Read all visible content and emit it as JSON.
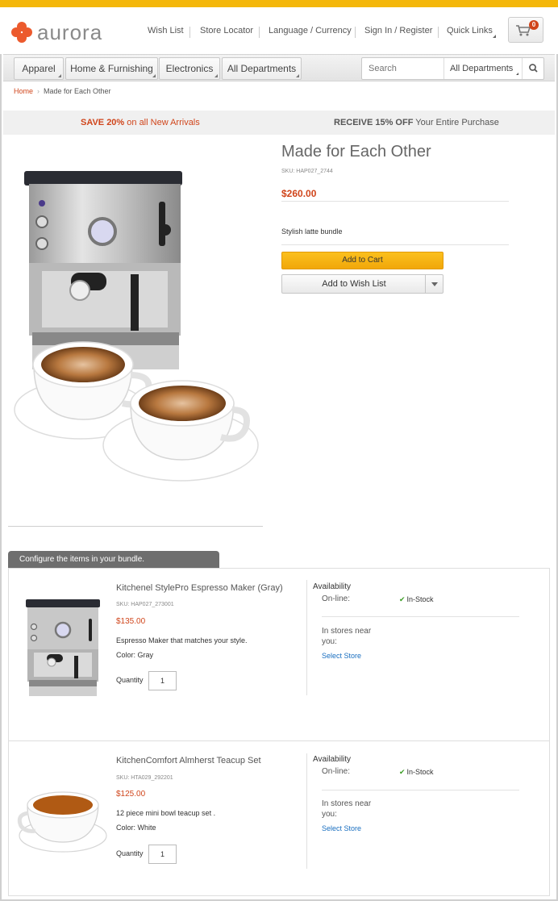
{
  "brand": {
    "name": "aurora"
  },
  "header": {
    "links": [
      "Wish List",
      "Store Locator",
      "Language / Currency",
      "Sign In / Register",
      "Quick Links"
    ],
    "cart_count": "0"
  },
  "nav": {
    "departments": [
      "Apparel",
      "Home & Furnishing",
      "Electronics",
      "All Departments"
    ],
    "search_placeholder": "Search",
    "search_department": "All Departments"
  },
  "breadcrumb": {
    "home": "Home",
    "current": "Made for Each Other"
  },
  "promo": {
    "left_bold": "SAVE 20%",
    "left_text": " on all New Arrivals",
    "right_bold": "RECEIVE 15% OFF",
    "right_text": " Your Entire Purchase"
  },
  "product": {
    "title": "Made for Each Other",
    "sku": "SKU: HAP027_2744",
    "price": "$260.00",
    "description": "Stylish latte bundle",
    "add_to_cart": "Add to Cart",
    "add_to_wishlist": "Add to Wish List"
  },
  "bundle": {
    "tab_label": "Configure the items in your bundle.",
    "items": [
      {
        "name": "Kitchenel StylePro Espresso Maker (Gray)",
        "sku": "SKU: HAP027_273001",
        "price": "$135.00",
        "description": "Espresso Maker that matches your style.",
        "color": "Color: Gray",
        "quantity_label": "Quantity",
        "quantity": "1",
        "availability_label": "Availability",
        "online_label": "On-line:",
        "online_status": "In-Stock",
        "stores_label": "In stores near you:",
        "select_store": "Select Store"
      },
      {
        "name": "KitchenComfort Almherst Teacup Set",
        "sku": "SKU: HTA029_292201",
        "price": "$125.00",
        "description": "12 piece mini bowl teacup set .",
        "color": "Color: White",
        "quantity_label": "Quantity",
        "quantity": "1",
        "availability_label": "Availability",
        "online_label": "On-line:",
        "online_status": "In-Stock",
        "stores_label": "In stores near you:",
        "select_store": "Select Store"
      }
    ]
  },
  "colors": {
    "accent": "#f4b70a",
    "brand": "#ec5a2d",
    "price": "#d0451b",
    "link": "#1a6fc0",
    "stock": "#3a9d23"
  }
}
